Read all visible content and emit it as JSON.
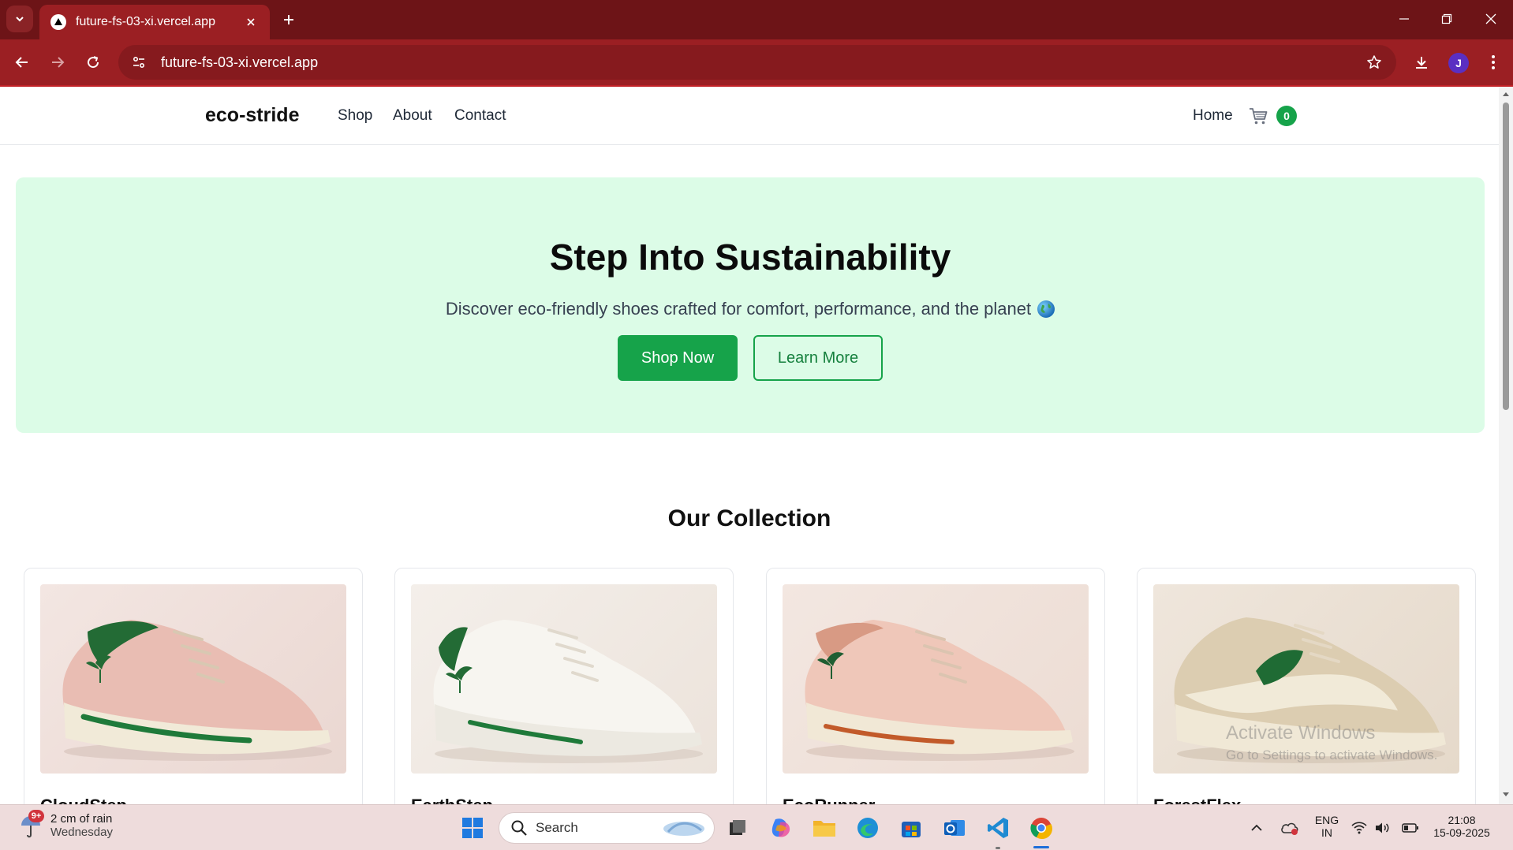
{
  "browser": {
    "tab_title": "future-fs-03-xi.vercel.app",
    "url": "future-fs-03-xi.vercel.app",
    "profile_initial": "J",
    "colors": {
      "frame": "#6d1417",
      "toolbar": "#9b1f23"
    }
  },
  "site": {
    "brand": "eco-stride",
    "nav": [
      {
        "label": "Shop"
      },
      {
        "label": "About"
      },
      {
        "label": "Contact"
      }
    ],
    "home_label": "Home",
    "cart_count": "0",
    "accent_color": "#16a34a"
  },
  "hero": {
    "title": "Step Into Sustainability",
    "subtitle": "Discover eco-friendly shoes crafted for comfort, performance, and the planet",
    "primary_button": "Shop Now",
    "secondary_button": "Learn More",
    "background": "#dcfce7"
  },
  "collection": {
    "title": "Our Collection",
    "products": [
      {
        "name": "CloudStep",
        "shoe_color": "pink",
        "accent": "green"
      },
      {
        "name": "EarthStep",
        "shoe_color": "white",
        "accent": "green"
      },
      {
        "name": "EcoRunner",
        "shoe_color": "peach",
        "accent": "orange"
      },
      {
        "name": "ForestFlex",
        "shoe_color": "beige",
        "accent": "green"
      }
    ]
  },
  "watermark": {
    "line1": "Activate Windows",
    "line2": "Go to Settings to activate Windows."
  },
  "taskbar": {
    "weather_badge": "9+",
    "weather_line1": "2 cm of rain",
    "weather_line2": "Wednesday",
    "search_label": "Search",
    "lang_line1": "ENG",
    "lang_line2": "IN",
    "time": "21:08",
    "date": "15-09-2025"
  }
}
